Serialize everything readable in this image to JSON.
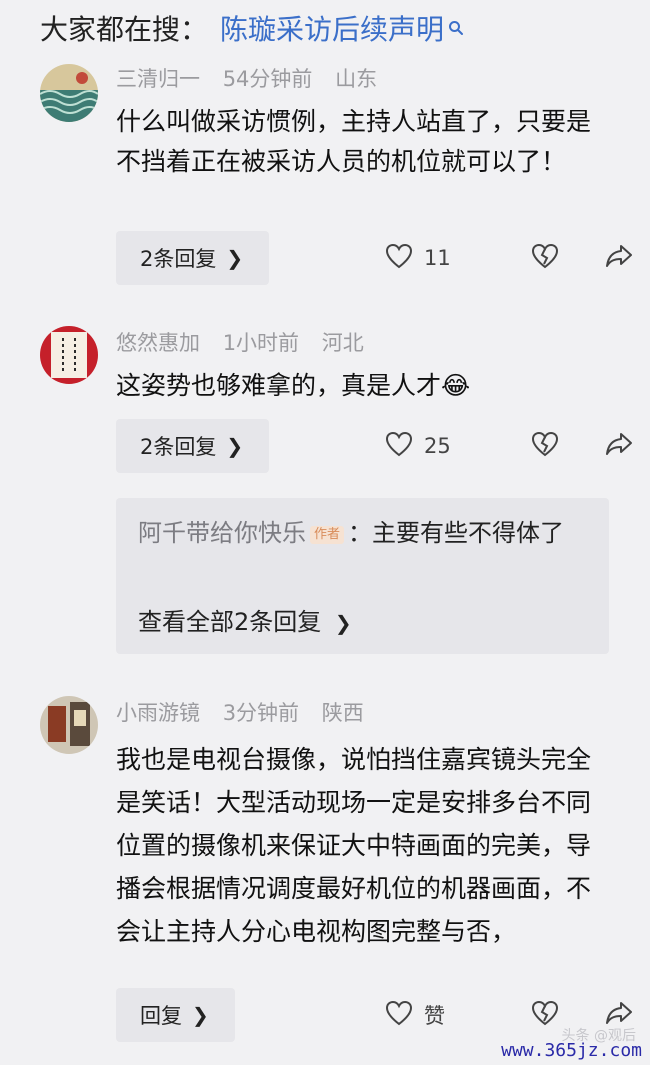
{
  "search_bar": {
    "prefix": "大家都在搜：",
    "query": "陈璇采访后续声明",
    "icon": "search-icon"
  },
  "comments": [
    {
      "username": "三清归一",
      "time": "54分钟前",
      "location": "山东",
      "text": "什么叫做采访惯例，主持人站直了，只要是不挡着正在被采访人员的机位就可以了！",
      "replies_label": "2条回复",
      "like_count": "11"
    },
    {
      "username": "悠然惠加",
      "time": "1小时前",
      "location": "河北",
      "text": "这姿势也够难拿的，真是人才",
      "emoji": "😂",
      "replies_label": "2条回复",
      "like_count": "25",
      "reply_preview": {
        "author": "阿千带给你快乐",
        "author_tag": "作者",
        "text": "：主要有些不得体了",
        "view_all": "查看全部2条回复"
      }
    },
    {
      "username": "小雨游镜",
      "time": "3分钟前",
      "location": "陕西",
      "text": "我也是电视台摄像，说怕挡住嘉宾镜头完全是笑话！大型活动现场一定是安排多台不同位置的摄像机来保证大中特画面的完美，导播会根据情况调度最好机位的机器画面，不会让主持人分心电视构图完整与否，",
      "replies_label": "回复",
      "like_label": "赞"
    }
  ],
  "watermark": "www.365jz.com",
  "watermark_faint": "头条 @观后"
}
